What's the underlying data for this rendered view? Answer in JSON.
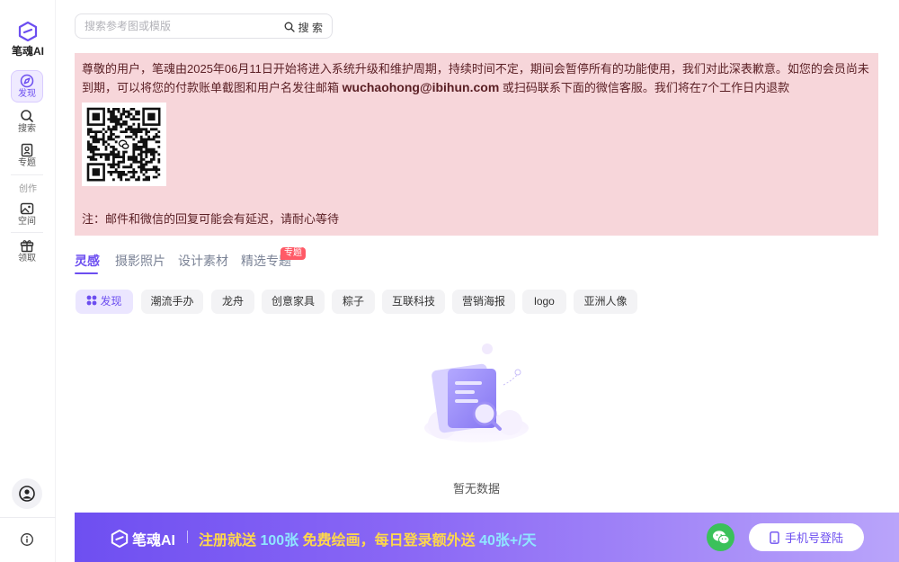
{
  "brand": {
    "name": "笔魂AI",
    "accent": "#6c4ef0"
  },
  "sidebar": {
    "items": [
      {
        "label": "发现",
        "icon": "compass-icon",
        "active": true
      },
      {
        "label": "搜索",
        "icon": "search-icon"
      },
      {
        "label": "专题",
        "icon": "bookmark-icon"
      }
    ],
    "section_label": "创作",
    "items2": [
      {
        "label": "空间",
        "icon": "image-icon"
      },
      {
        "label": "领取",
        "icon": "gift-icon"
      }
    ]
  },
  "search": {
    "placeholder": "搜索参考图或模版",
    "button_label": "搜 索"
  },
  "notice": {
    "text_before": "尊敬的用户，笔魂由2025年06月11日开始将进入系统升级和维护周期，持续时间不定，期间会暂停所有的功能使用，我们对此深表歉意。如您的会员尚未到期，可以将您的付款账单截图和用户名发往邮箱 ",
    "email": "wuchaohong@ibihun.com",
    "text_after": " 或扫码联系下面的微信客服。我们将在7个工作日内退款",
    "note": "注：邮件和微信的回复可能会有延迟，请耐心等待",
    "bg_color": "#f7d6da"
  },
  "tabs": [
    {
      "label": "灵感",
      "active": true
    },
    {
      "label": "摄影照片"
    },
    {
      "label": "设计素材"
    },
    {
      "label": "精选专题"
    }
  ],
  "tab_badge": "专题",
  "chips": [
    {
      "label": "发现",
      "active": true
    },
    {
      "label": "潮流手办"
    },
    {
      "label": "龙舟"
    },
    {
      "label": "创意家具"
    },
    {
      "label": "粽子"
    },
    {
      "label": "互联科技"
    },
    {
      "label": "营销海报"
    },
    {
      "label": "logo"
    },
    {
      "label": "亚洲人像"
    }
  ],
  "empty": {
    "text": "暂无数据"
  },
  "banner": {
    "logo": "笔魂AI",
    "promo_p1": "注册就送 ",
    "promo_hl1": "100张",
    "promo_p2": " 免费绘画，每日登录额外送 ",
    "promo_hl2": "40张+/天",
    "login_label": "手机号登陆"
  }
}
